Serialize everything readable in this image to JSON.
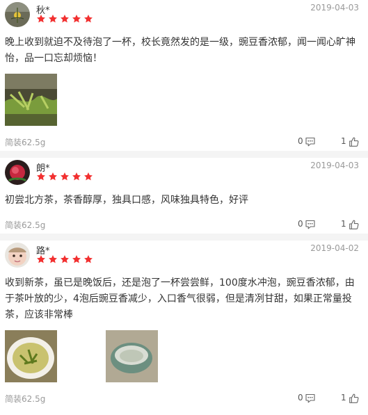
{
  "colors": {
    "star": "#f23030",
    "muted": "#9a9a9a",
    "separator": "#f4f4f4"
  },
  "reviews": [
    {
      "username": "秋*",
      "date": "2019-04-03",
      "rating": 5,
      "content": "晚上收到就迫不及待泡了一杯，校长竟然发的是一级，豌豆香浓郁，闻一闻心旷神怡，品一口忘却烦恼！",
      "spec": "简装62.5g",
      "comment_count": "0",
      "like_count": "1",
      "comment_icon": "comment-icon",
      "like_icon": "thumb-up-icon"
    },
    {
      "username": "朗*",
      "date": "2019-04-03",
      "rating": 5,
      "content": "初尝北方茶，茶香醇厚，独具口感，风味独具特色，好评",
      "spec": "简装62.5g",
      "comment_count": "0",
      "like_count": "1",
      "comment_icon": "comment-icon",
      "like_icon": "thumb-up-icon"
    },
    {
      "username": "路*",
      "date": "2019-04-02",
      "rating": 5,
      "content": "收到新茶，虽已是晚饭后，还是泡了一杯尝尝鲜，100度水冲泡，豌豆香浓郁，由于茶叶放的少，4泡后豌豆香减少，入口香气很弱，但是清冽甘甜，如果正常量投茶，应该非常棒",
      "spec": "简装62.5g",
      "comment_count": "0",
      "like_count": "1",
      "comment_icon": "comment-icon",
      "like_icon": "thumb-up-icon"
    }
  ]
}
